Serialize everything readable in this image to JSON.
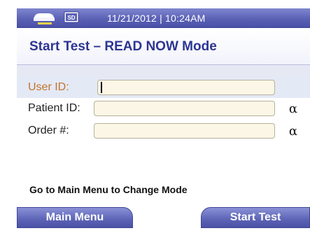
{
  "status_bar": {
    "datetime": "11/21/2012 | 10:24AM",
    "icons": [
      "printer-icon",
      "sd-card-icon"
    ],
    "sd_label": "SD"
  },
  "header": {
    "title": "Start Test – READ NOW Mode"
  },
  "form": {
    "user_id": {
      "label": "User ID:",
      "value": ""
    },
    "patient_id": {
      "label": "Patient ID:",
      "value": "",
      "alpha_key": "α"
    },
    "order_number": {
      "label": "Order #:",
      "value": "",
      "alpha_key": "α"
    }
  },
  "message": "Go to Main Menu to Change Mode",
  "buttons": {
    "main_menu": "Main Menu",
    "start_test": "Start Test"
  },
  "colors": {
    "accent": "#5c63b6",
    "title": "#2d3592",
    "active_label": "#c0742c",
    "field_bg": "#fbf6e6"
  }
}
